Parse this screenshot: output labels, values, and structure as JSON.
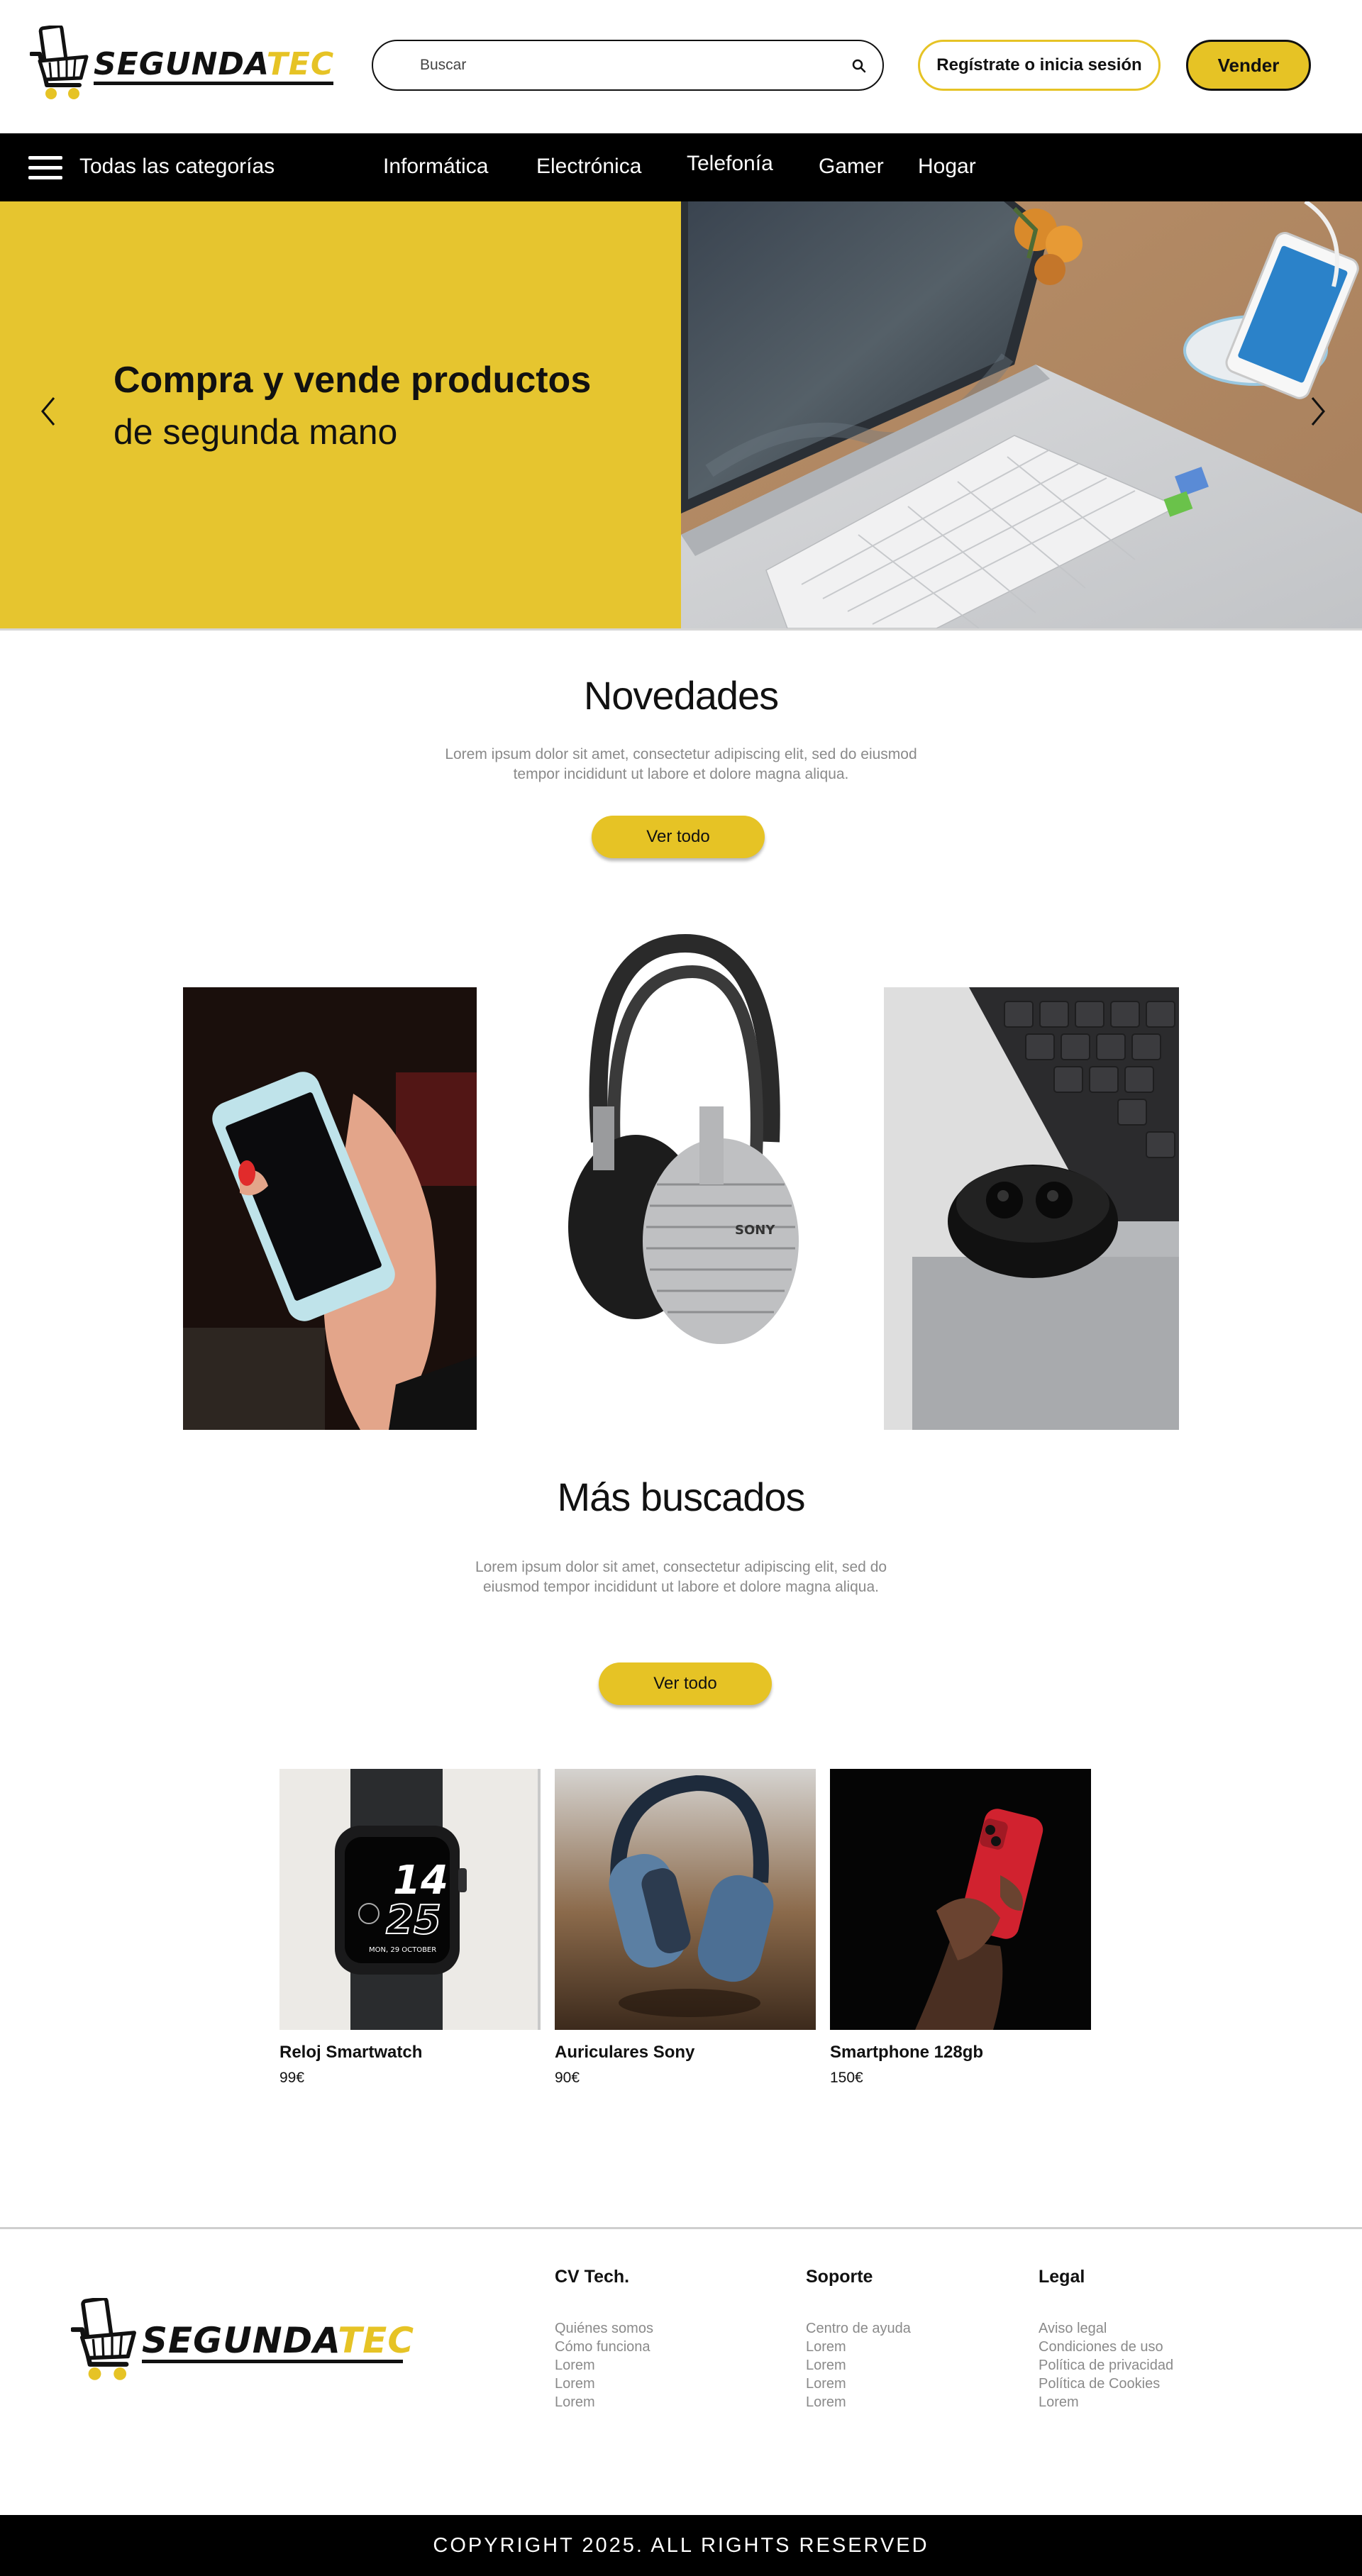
{
  "brand": {
    "logo_part1": "SEGUNDA",
    "logo_part2": "TEC",
    "accent_color": "#e6c325",
    "cart_icon": "shopping-cart-phone-icon"
  },
  "header": {
    "search": {
      "placeholder": "Buscar",
      "icon": "search-icon"
    },
    "login_label": "Regístrate o inicia sesión",
    "sell_label": "Vender"
  },
  "nav": {
    "all_categories": "Todas las categorías",
    "menu_icon": "hamburger-menu-icon",
    "links": [
      "Informática",
      "Electrónica",
      "Telefonía",
      "Gamer",
      "Hogar"
    ]
  },
  "hero": {
    "title": "Compra y vende productos",
    "subtitle": "de segunda mano",
    "prev_icon": "chevron-left-icon",
    "next_icon": "chevron-right-icon",
    "image": "laptop-and-smartphone-on-wireless-charger-photo"
  },
  "novedades": {
    "title": "Novedades",
    "description": "Lorem ipsum dolor sit amet, consectetur adipiscing elit, sed do eiusmod tempor incididunt ut labore et dolore magna aliqua.",
    "button": "Ver todo",
    "images": [
      "hand-holding-smartphone-photo",
      "sony-headphones-photo",
      "wireless-earbuds-on-laptop-photo"
    ]
  },
  "mas_buscados": {
    "title": "Más buscados",
    "description": "Lorem ipsum dolor sit amet, consectetur adipiscing elit, sed do eiusmod tempor incididunt ut labore et dolore magna aliqua.",
    "button": "Ver todo",
    "watch_face": {
      "hour": "14",
      "minute": "25",
      "date": "MON, 29 OCTOBER"
    },
    "products": [
      {
        "name": "Reloj Smartwatch",
        "price": "99€"
      },
      {
        "name": "Auriculares Sony",
        "price": "90€"
      },
      {
        "name": "Smartphone 128gb",
        "price": "150€"
      }
    ]
  },
  "footer": {
    "columns": [
      {
        "title": "CV Tech.",
        "links": [
          "Quiénes somos",
          "Cómo funciona",
          "Lorem",
          "Lorem",
          "Lorem"
        ]
      },
      {
        "title": "Soporte",
        "links": [
          "Centro de ayuda",
          "Lorem",
          "Lorem",
          "Lorem",
          "Lorem"
        ]
      },
      {
        "title": "Legal",
        "links": [
          "Aviso legal",
          "Condiciones de uso",
          "Política de privacidad",
          "Política de Cookies",
          "Lorem"
        ]
      }
    ],
    "copyright": "COPYRIGHT 2025. ALL RIGHTS RESERVED"
  }
}
